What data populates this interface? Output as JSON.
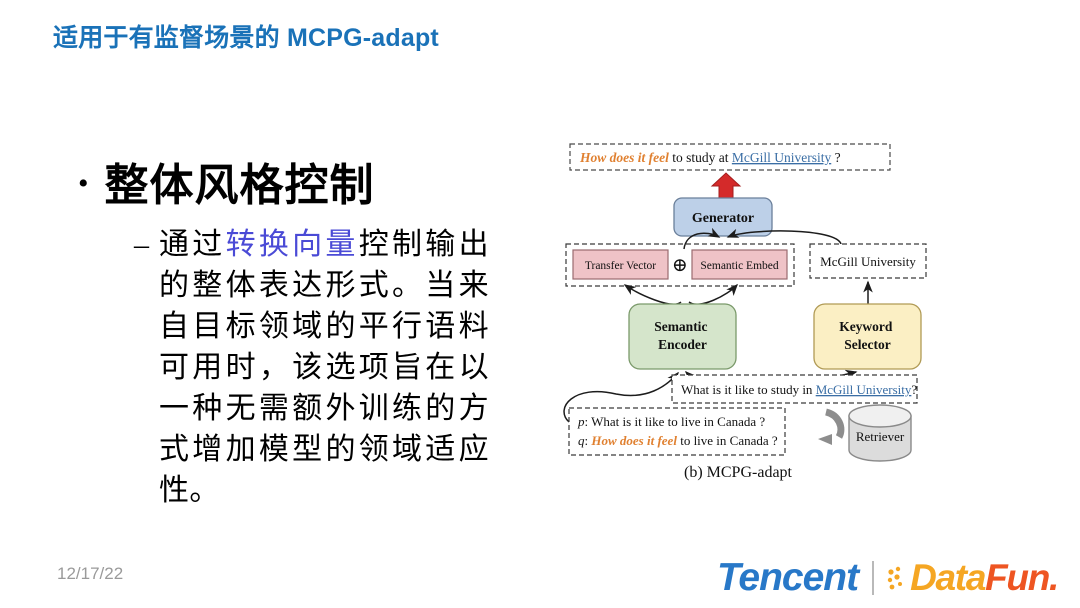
{
  "slide": {
    "title": "适用于有监督场景的 MCPG-adapt",
    "title_color": "#1a72b8"
  },
  "body": {
    "bullet_glyph": "•",
    "level1": "整体风格控制",
    "dash_glyph": "–",
    "level2": {
      "part1": "通过",
      "highlight": "转换向量",
      "highlight_color": "#4a4ad6",
      "part2": "控制输出的整体表达形式。当来自目标领域的平行语料可用时，该选项旨在以一种无需额外训练的方式增加模型的领域适应性。"
    }
  },
  "figure": {
    "caption": "(b) MCPG-adapt",
    "output_box": {
      "styled_phrase": "How does it feel",
      "styled_color": "#e08030",
      "mid_text": " to study at ",
      "link_text": "McGill University",
      "link_color": "#3a6ea5",
      "tail_text": " ?"
    },
    "generator": {
      "label": "Generator",
      "fill": "#bdd0e8",
      "stroke": "#6a7f9a"
    },
    "transfer_vector": {
      "label": "Transfer Vector",
      "fill": "#efc3c7",
      "stroke": "#9a6b70"
    },
    "plus_symbol": "⊕",
    "semantic_embed": {
      "label": "Semantic Embed",
      "fill": "#efc3c7",
      "stroke": "#9a6b70"
    },
    "keyword_box": {
      "label": "McGill University"
    },
    "semantic_encoder": {
      "line1": "Semantic",
      "line2": "Encoder",
      "fill": "#d5e5cb",
      "stroke": "#7b9a6b"
    },
    "keyword_selector": {
      "line1": "Keyword",
      "line2": "Selector",
      "fill": "#fbefc4",
      "stroke": "#b09a55"
    },
    "query_box": {
      "pre_text": "What is it like to study in ",
      "link_text": "McGill University",
      "link_color": "#3a6ea5",
      "tail_text": "?"
    },
    "pair_box": {
      "p_label": "p",
      "p_sep": ": ",
      "p_text": "What is it like to live in Canada ?",
      "q_label": "q",
      "q_sep": ": ",
      "q_styled": "How does it feel",
      "q_styled_color": "#e08030",
      "q_text": " to live in Canada ?"
    },
    "retriever": {
      "label": "Retriever",
      "fill": "#dcdcdc",
      "stroke": "#8a8a8a"
    },
    "red_arrow_color": "#d42a2a"
  },
  "footer": {
    "date": "12/17/22",
    "tencent": "Tencent",
    "divider": "|",
    "datafun_data": "Data",
    "datafun_fun": "Fun",
    "datafun_dot": "."
  }
}
